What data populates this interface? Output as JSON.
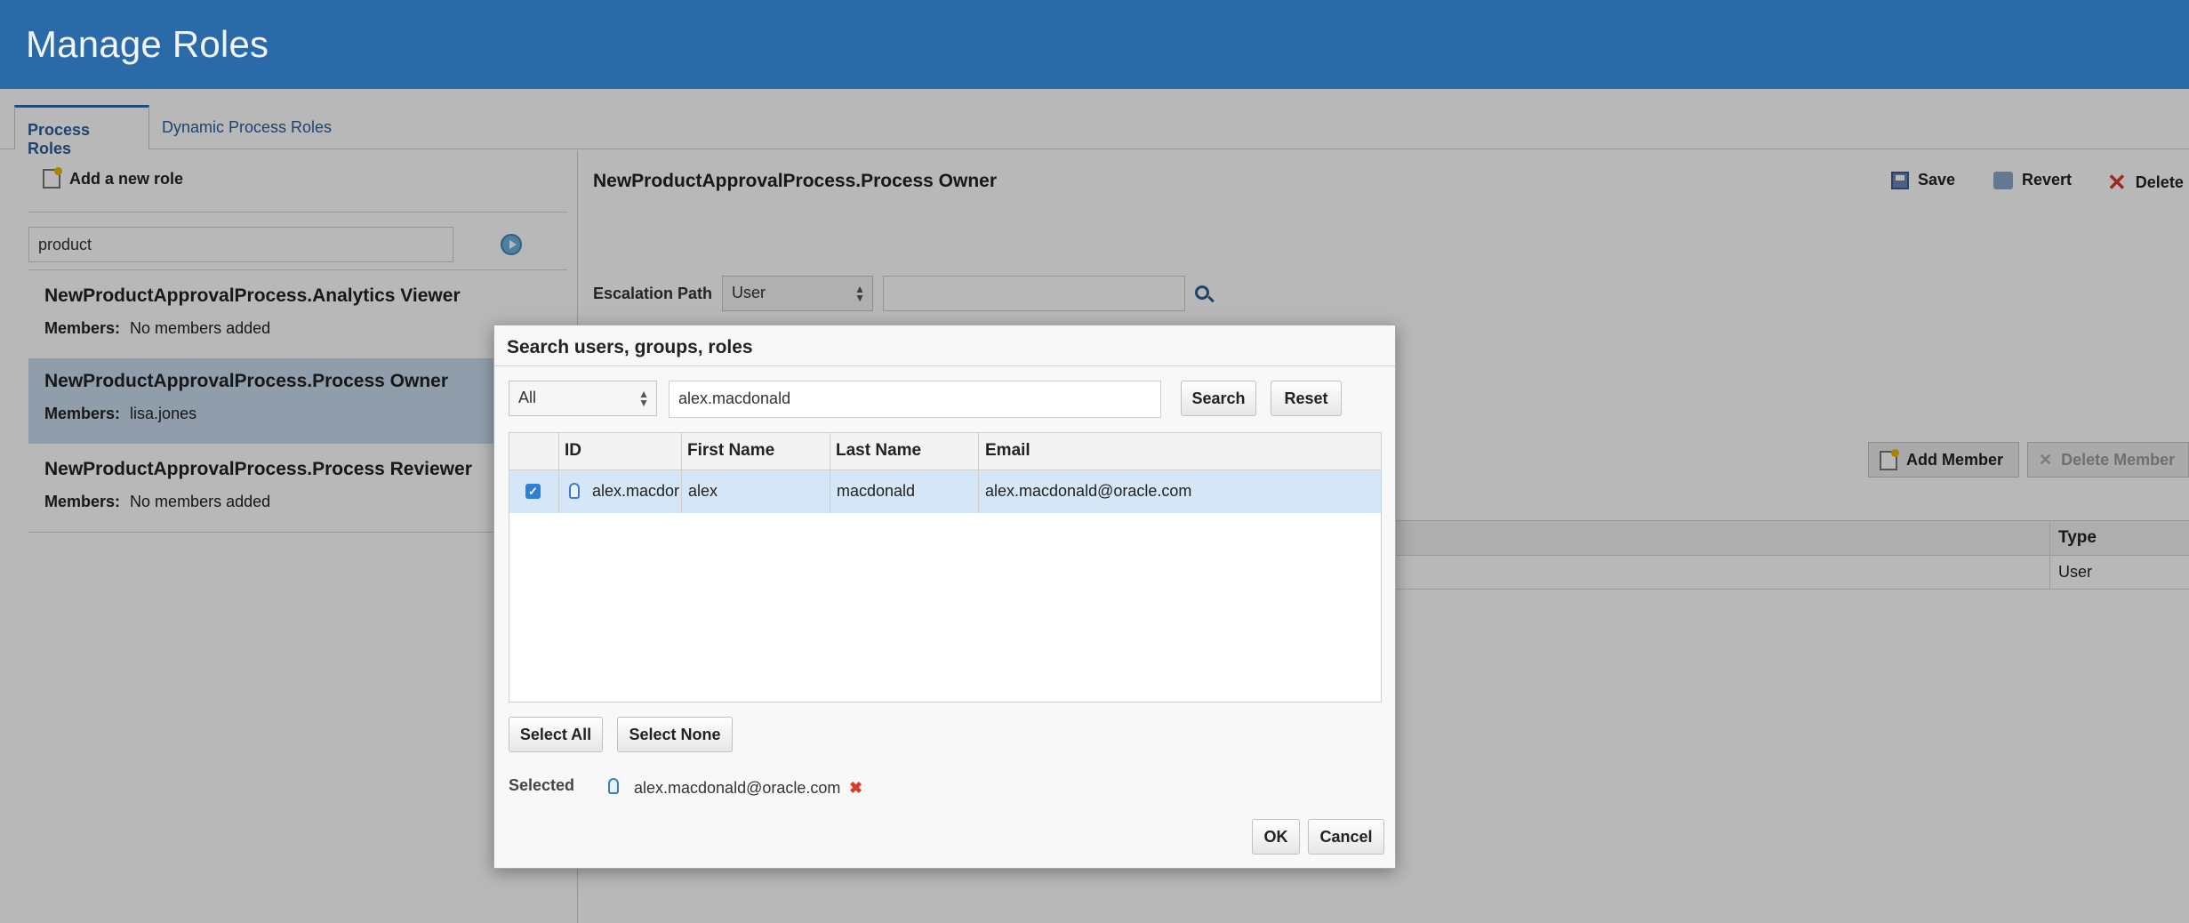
{
  "header": {
    "title": "Manage Roles"
  },
  "tabs": [
    {
      "label": "Process Roles",
      "active": true
    },
    {
      "label": "Dynamic Process Roles",
      "active": false
    }
  ],
  "left": {
    "add_role_label": "Add a new role",
    "search_value": "product",
    "roles": [
      {
        "name": "NewProductApprovalProcess.Analytics Viewer",
        "members_label": "Members:",
        "members": "No members added"
      },
      {
        "name": "NewProductApprovalProcess.Process Owner",
        "members_label": "Members:",
        "members": "lisa.jones",
        "selected": true
      },
      {
        "name": "NewProductApprovalProcess.Process Reviewer",
        "members_label": "Members:",
        "members": "No members added"
      }
    ]
  },
  "right": {
    "title": "NewProductApprovalProcess.Process Owner",
    "toolbar": {
      "save": "Save",
      "revert": "Revert",
      "delete": "Delete"
    },
    "escalation_label": "Escalation Path",
    "escalation_type": "User",
    "escalation_value": "",
    "add_member": "Add Member",
    "delete_member": "Delete Member",
    "members_table": {
      "type_header": "Type",
      "rows": [
        {
          "type": "User"
        }
      ]
    }
  },
  "dialog": {
    "title": "Search users, groups, roles",
    "filter": "All",
    "query": "alex.macdonald",
    "search_button": "Search",
    "reset_button": "Reset",
    "columns": [
      "ID",
      "First Name",
      "Last Name",
      "Email"
    ],
    "rows": [
      {
        "id": "alex.macdor",
        "first": "alex",
        "last": "macdonald",
        "email": "alex.macdonald@oracle.com",
        "checked": true
      }
    ],
    "select_all": "Select All",
    "select_none": "Select None",
    "selected_label": "Selected",
    "selected_value": "alex.macdonald@oracle.com",
    "ok": "OK",
    "cancel": "Cancel"
  },
  "colors": {
    "header_bg": "#2a6aa8",
    "link": "#2a5e99",
    "selected_row": "#c8dbef",
    "delete_red": "#d63b2b"
  }
}
